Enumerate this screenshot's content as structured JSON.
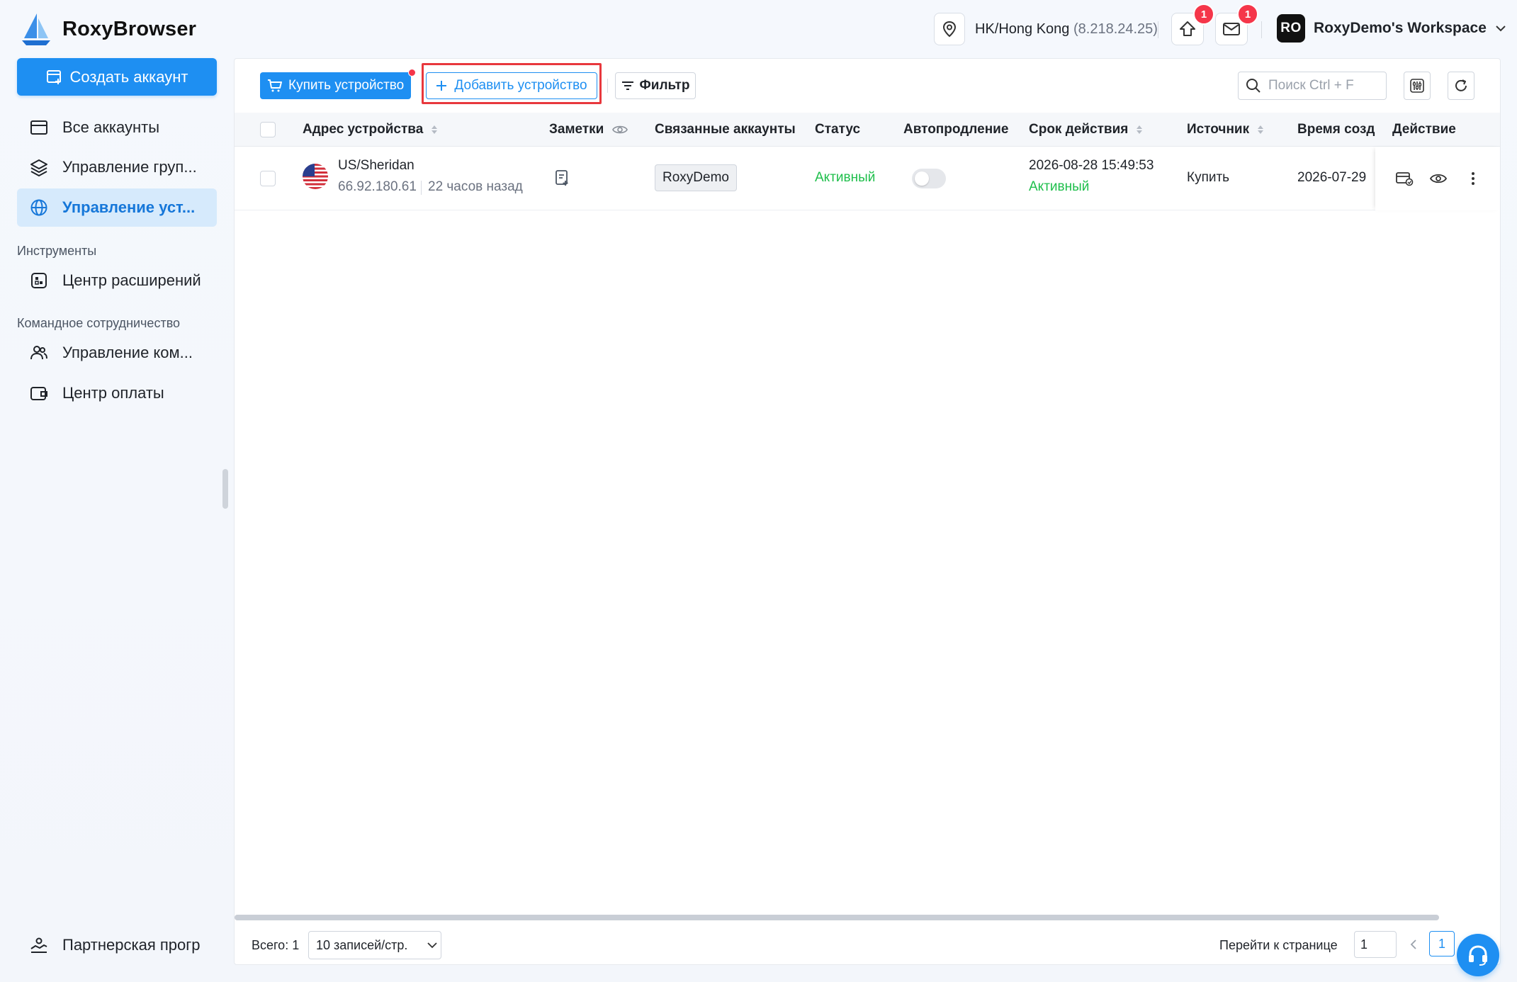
{
  "app": {
    "name": "RoxyBrowser"
  },
  "header": {
    "location": "HK/Hong Kong",
    "ip": "(8.218.24.25)",
    "upgrade_badge": "1",
    "mail_badge": "1",
    "workspace_avatar": "RO",
    "workspace_name": "RoxyDemo's Workspace"
  },
  "sidebar": {
    "create_label": "Создать аккаунт",
    "items": [
      {
        "label": "Все аккаунты",
        "icon": "window-icon"
      },
      {
        "label": "Управление груп...",
        "icon": "layers-icon"
      },
      {
        "label": "Управление уст...",
        "icon": "globe-icon",
        "active": true
      }
    ],
    "section_tools": "Инструменты",
    "tools_items": [
      {
        "label": "Центр расширений",
        "icon": "extension-icon"
      }
    ],
    "section_team": "Командное сотрудничество",
    "team_items": [
      {
        "label": "Управление ком...",
        "icon": "users-icon"
      },
      {
        "label": "Центр оплаты",
        "icon": "wallet-icon"
      }
    ],
    "partner_label": "Партнерская прогр"
  },
  "toolbar": {
    "buy_label": "Купить устройство",
    "add_label": "Добавить устройство",
    "filter_label": "Фильтр",
    "search_placeholder": "Поиск Ctrl + F"
  },
  "table": {
    "columns": [
      "Адрес устройства",
      "Заметки",
      "Связанные аккаунты",
      "Статус",
      "Автопродление",
      "Срок действия",
      "Источник",
      "Время созда",
      "Действие"
    ],
    "rows": [
      {
        "location": "US/Sheridan",
        "ip": "66.92.180.61",
        "ago": "22 часов назад",
        "account": "RoxyDemo",
        "status": "Активный",
        "autorenew": false,
        "expiry": "2026-08-28 15:49:53",
        "expiry_status": "Активный",
        "source": "Купить",
        "created": "2026-07-29"
      }
    ]
  },
  "footer": {
    "total": "Всего: 1",
    "page_size": "10 записей/стр.",
    "goto_label": "Перейти к странице",
    "goto_value": "1",
    "current_page": "1"
  },
  "colors": {
    "accent": "#1e8ff2",
    "success": "#1fbf4c",
    "danger": "#f5364a",
    "highlight": "#e8383d"
  }
}
